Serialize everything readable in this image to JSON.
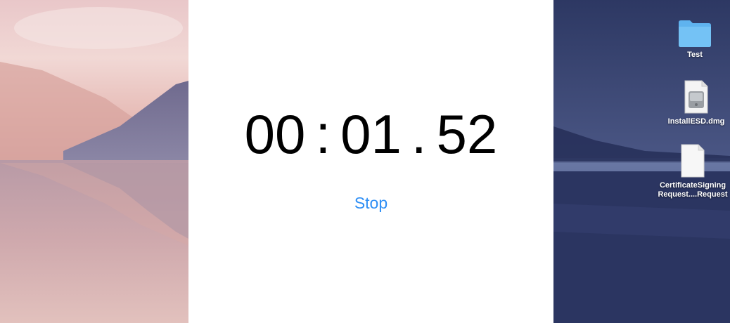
{
  "timer": {
    "minutes": "00",
    "seconds": "01",
    "hundredths": "52",
    "separator_1": ":",
    "separator_2": "."
  },
  "stop_button": {
    "label": "Stop",
    "color": "#2f8ff5"
  },
  "desktop": {
    "icons": [
      {
        "label": "Test",
        "icon": "folder-icon"
      },
      {
        "label": "InstallESD.dmg",
        "icon": "disk-image-icon"
      },
      {
        "label_line1": "CertificateSigning",
        "label_line2": "Request....Request",
        "icon": "document-icon"
      }
    ]
  }
}
